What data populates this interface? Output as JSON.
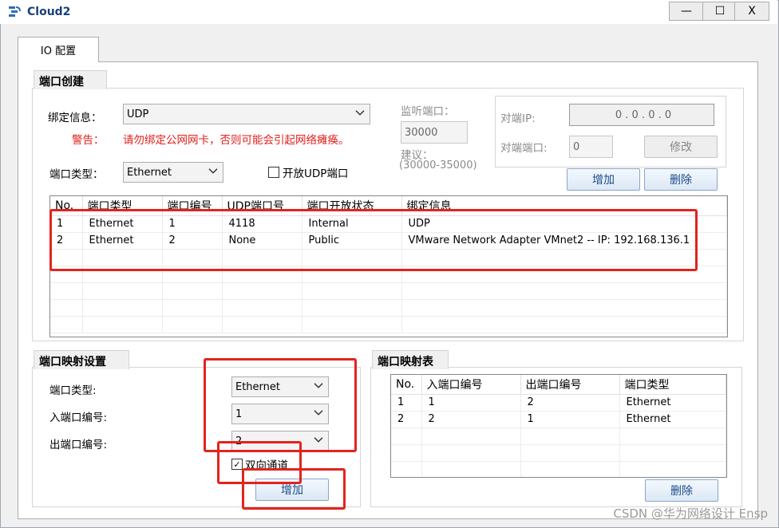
{
  "window": {
    "title": "Cloud2",
    "minimize_glyph": "—",
    "maximize_glyph": "☐",
    "close_glyph": "X"
  },
  "tabs": [
    {
      "label": "IO 配置",
      "active": true
    }
  ],
  "port_create": {
    "title": "端口创建",
    "bind_label": "绑定信息：",
    "bind_value": "UDP",
    "warning_label": "警告：",
    "warning_text": "请勿绑定公网网卡，否则可能会引起网络瘫痪。",
    "port_type_label": "端口类型：",
    "port_type_value": "Ethernet",
    "open_udp_label": "开放UDP端口",
    "open_udp_checked": false,
    "listen_port_label": "监听端口：",
    "listen_port_value": "30000",
    "suggest_label": "建议：",
    "suggest_range": "(30000-35000)",
    "peer_ip_label": "对端IP:",
    "peer_ip_value": "0   .   0   .   0   .   0",
    "peer_port_label": "对端端口:",
    "peer_port_value": "0",
    "modify_button": "修改",
    "add_button": "增加",
    "delete_button": "删除"
  },
  "port_table": {
    "columns": [
      "No.",
      "端口类型",
      "端口编号",
      "UDP端口号",
      "端口开放状态",
      "绑定信息"
    ],
    "rows": [
      [
        "1",
        "Ethernet",
        "1",
        "4118",
        "Internal",
        "UDP"
      ],
      [
        "2",
        "Ethernet",
        "2",
        "None",
        "Public",
        "VMware Network Adapter VMnet2 -- IP: 192.168.136.1"
      ]
    ]
  },
  "port_map_settings": {
    "title": "端口映射设置",
    "port_type_label": "端口类型:",
    "port_type_value": "Ethernet",
    "in_port_label": "入端口编号:",
    "in_port_value": "1",
    "out_port_label": "出端口编号:",
    "out_port_value": "2",
    "bidirectional_label": "双向通道",
    "bidirectional_checked": true,
    "add_button": "增加"
  },
  "port_map_table": {
    "title": "端口映射表",
    "columns": [
      "No.",
      "入端口编号",
      "出端口编号",
      "端口类型"
    ],
    "rows": [
      [
        "1",
        "1",
        "2",
        "Ethernet"
      ],
      [
        "2",
        "2",
        "1",
        "Ethernet"
      ]
    ],
    "delete_button": "删除"
  },
  "watermark": "CSDN @华为网络设计 Ensp",
  "colors": {
    "annotation_red": "#e3231c",
    "warning_red": "#e0201c",
    "title_blue": "#1b3f7a"
  }
}
